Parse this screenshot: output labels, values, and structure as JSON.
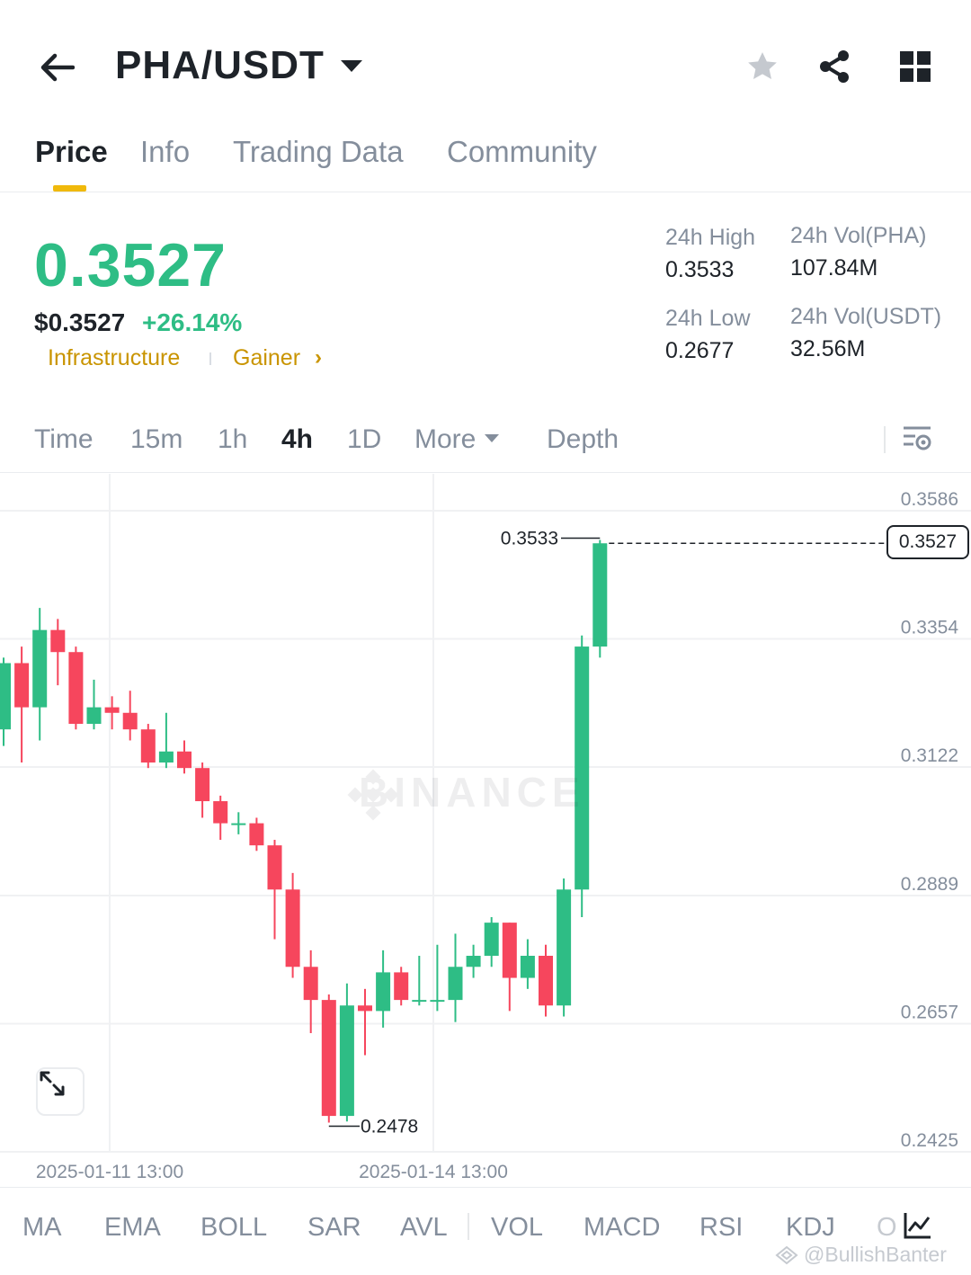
{
  "header": {
    "pair": "PHA/USDT"
  },
  "tabs": [
    {
      "label": "Price",
      "active": true
    },
    {
      "label": "Info",
      "active": false
    },
    {
      "label": "Trading Data",
      "active": false
    },
    {
      "label": "Community",
      "active": false
    }
  ],
  "price": {
    "last": "0.3527",
    "usd": "$0.3527",
    "change": "+26.14%",
    "tags": [
      "Infrastructure",
      "Gainer"
    ]
  },
  "stats": {
    "high_label": "24h High",
    "high_value": "0.3533",
    "low_label": "24h Low",
    "low_value": "0.2677",
    "vol_base_label": "24h Vol(PHA)",
    "vol_base_value": "107.84M",
    "vol_quote_label": "24h Vol(USDT)",
    "vol_quote_value": "32.56M"
  },
  "intervals": {
    "items": [
      "Time",
      "15m",
      "1h",
      "4h",
      "1D"
    ],
    "active": "4h",
    "more_label": "More",
    "depth_label": "Depth"
  },
  "chart_data": {
    "type": "candlestick",
    "y_axis_ticks": [
      "0.3586",
      "0.3354",
      "0.3122",
      "0.2889",
      "0.2657",
      "0.2425"
    ],
    "ylim": [
      0.2425,
      0.3586
    ],
    "x_axis_ticks": [
      "2025-01-11 13:00",
      "2025-01-14 13:00"
    ],
    "high_marker": "0.3533",
    "low_marker": "0.2478",
    "current_price": "0.3527",
    "watermark": "BINANCE",
    "colors": {
      "up": "#2ebd85",
      "down": "#f6465d",
      "grid": "#f0f1f3"
    },
    "candles": [
      {
        "o": 0.319,
        "c": 0.331,
        "h": 0.332,
        "l": 0.316
      },
      {
        "o": 0.331,
        "c": 0.323,
        "h": 0.334,
        "l": 0.313
      },
      {
        "o": 0.323,
        "c": 0.337,
        "h": 0.341,
        "l": 0.317
      },
      {
        "o": 0.337,
        "c": 0.333,
        "h": 0.339,
        "l": 0.327
      },
      {
        "o": 0.333,
        "c": 0.32,
        "h": 0.334,
        "l": 0.319
      },
      {
        "o": 0.32,
        "c": 0.323,
        "h": 0.328,
        "l": 0.319
      },
      {
        "o": 0.323,
        "c": 0.322,
        "h": 0.325,
        "l": 0.319
      },
      {
        "o": 0.322,
        "c": 0.319,
        "h": 0.326,
        "l": 0.317
      },
      {
        "o": 0.319,
        "c": 0.313,
        "h": 0.32,
        "l": 0.312
      },
      {
        "o": 0.313,
        "c": 0.315,
        "h": 0.322,
        "l": 0.312
      },
      {
        "o": 0.315,
        "c": 0.312,
        "h": 0.317,
        "l": 0.311
      },
      {
        "o": 0.312,
        "c": 0.306,
        "h": 0.313,
        "l": 0.303
      },
      {
        "o": 0.306,
        "c": 0.302,
        "h": 0.307,
        "l": 0.299
      },
      {
        "o": 0.302,
        "c": 0.302,
        "h": 0.304,
        "l": 0.3
      },
      {
        "o": 0.302,
        "c": 0.298,
        "h": 0.303,
        "l": 0.297
      },
      {
        "o": 0.298,
        "c": 0.29,
        "h": 0.299,
        "l": 0.281
      },
      {
        "o": 0.29,
        "c": 0.276,
        "h": 0.293,
        "l": 0.274
      },
      {
        "o": 0.276,
        "c": 0.27,
        "h": 0.279,
        "l": 0.264
      },
      {
        "o": 0.27,
        "c": 0.249,
        "h": 0.271,
        "l": 0.2478
      },
      {
        "o": 0.249,
        "c": 0.269,
        "h": 0.273,
        "l": 0.248
      },
      {
        "o": 0.269,
        "c": 0.268,
        "h": 0.272,
        "l": 0.26
      },
      {
        "o": 0.268,
        "c": 0.275,
        "h": 0.279,
        "l": 0.265
      },
      {
        "o": 0.275,
        "c": 0.27,
        "h": 0.276,
        "l": 0.269
      },
      {
        "o": 0.27,
        "c": 0.27,
        "h": 0.278,
        "l": 0.269
      },
      {
        "o": 0.27,
        "c": 0.27,
        "h": 0.28,
        "l": 0.268
      },
      {
        "o": 0.27,
        "c": 0.276,
        "h": 0.282,
        "l": 0.266
      },
      {
        "o": 0.276,
        "c": 0.278,
        "h": 0.28,
        "l": 0.274
      },
      {
        "o": 0.278,
        "c": 0.284,
        "h": 0.285,
        "l": 0.276
      },
      {
        "o": 0.284,
        "c": 0.274,
        "h": 0.284,
        "l": 0.268
      },
      {
        "o": 0.274,
        "c": 0.278,
        "h": 0.281,
        "l": 0.272
      },
      {
        "o": 0.278,
        "c": 0.269,
        "h": 0.28,
        "l": 0.267
      },
      {
        "o": 0.269,
        "c": 0.29,
        "h": 0.292,
        "l": 0.267
      },
      {
        "o": 0.29,
        "c": 0.334,
        "h": 0.336,
        "l": 0.285
      },
      {
        "o": 0.334,
        "c": 0.3527,
        "h": 0.3533,
        "l": 0.332
      }
    ]
  },
  "indicators": [
    "MA",
    "EMA",
    "BOLL",
    "SAR",
    "AVL",
    "VOL",
    "MACD",
    "RSI",
    "KDJ",
    "O"
  ],
  "credit": "@BullishBanter"
}
